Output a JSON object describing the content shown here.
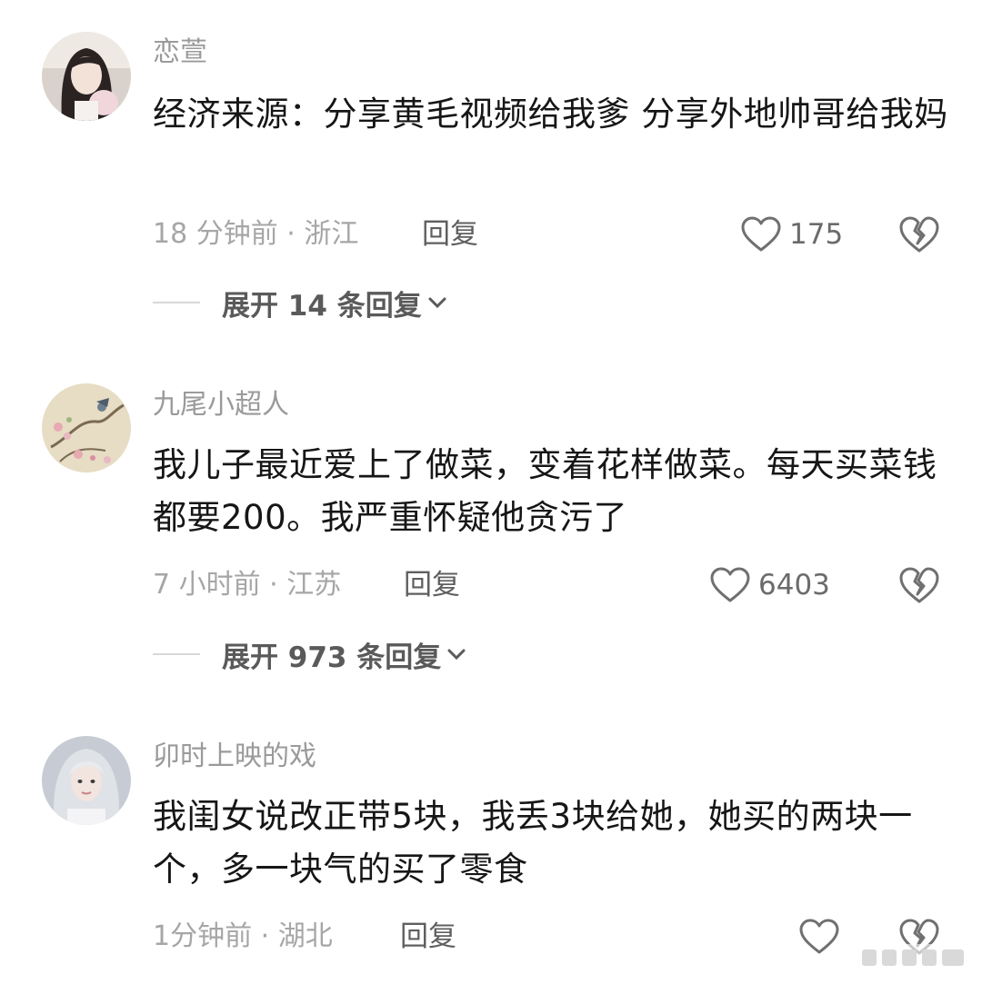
{
  "comments": [
    {
      "username": "恋萱",
      "text": "经济来源：分享黄毛视频给我爹 分享外地帅哥给我妈",
      "time_location": "18 分钟前 · 浙江",
      "reply_label": "回复",
      "likes": "175",
      "expand_label": "展开 14 条回复"
    },
    {
      "username": "九尾小超人",
      "text": "我儿子最近爱上了做菜，变着花样做菜。每天买菜钱都要200。我严重怀疑他贪污了",
      "time_location": "7 小时前 · 江苏",
      "reply_label": "回复",
      "likes": "6403",
      "expand_label": "展开 973 条回复"
    },
    {
      "username": "卯时上映的戏",
      "text": "我闺女说改正带5块，我丢3块给她，她买的两块一个，多一块气的买了零食",
      "time_location": "1分钟前 · 湖北",
      "reply_label": "回复",
      "likes": "",
      "expand_label": ""
    }
  ],
  "icons": {
    "like": "heart-outline-icon",
    "dislike": "broken-heart-icon",
    "expand": "chevron-down-icon"
  },
  "colors": {
    "username": "#9a9a9a",
    "body": "#161616",
    "meta": "#a6a6a6",
    "reply": "#5f5f5f",
    "icon_stroke": "#707070"
  }
}
